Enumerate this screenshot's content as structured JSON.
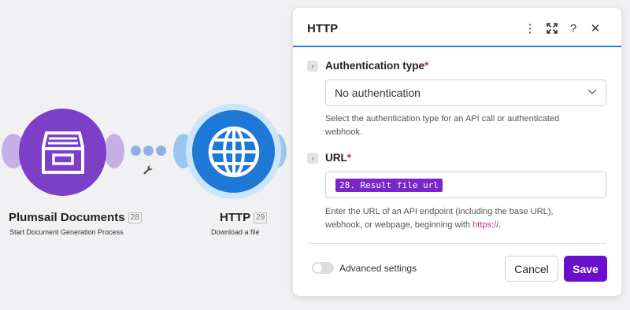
{
  "scenario": {
    "modules": [
      {
        "title": "Plumsail Documents",
        "badge": "28",
        "subtitle": "Start Document Generation Process",
        "icon": "file-cabinet-icon",
        "color": "#7b3fc8"
      },
      {
        "title": "HTTP",
        "badge": "29",
        "subtitle": "Download a file",
        "icon": "globe-icon",
        "color": "#1e78d6"
      }
    ],
    "connector": {
      "icon": "wrench-icon"
    }
  },
  "dialog": {
    "title": "HTTP",
    "header_icons": [
      "more-vertical-icon",
      "expand-icon",
      "help-icon",
      "close-icon"
    ],
    "header_help_glyph": "?",
    "header_close_glyph": "✕",
    "header_more_glyph": "⋮",
    "accent": "#2b7fd6",
    "auth": {
      "label": "Authentication type",
      "required_mark": "*",
      "value": "No authentication",
      "help": "Select the authentication type for an API call or authenticated webhook."
    },
    "url": {
      "label": "URL",
      "required_mark": "*",
      "value_pill": "28. Result file url",
      "help_prefix": "Enter the URL of an API endpoint (including the base URL), webhook, or webpage, beginning with ",
      "help_link": "https://",
      "help_suffix": "."
    },
    "advanced_settings_label": "Advanced settings",
    "advanced_settings_on": false,
    "cancel_label": "Cancel",
    "save_label": "Save",
    "save_color": "#6a0fd0"
  }
}
